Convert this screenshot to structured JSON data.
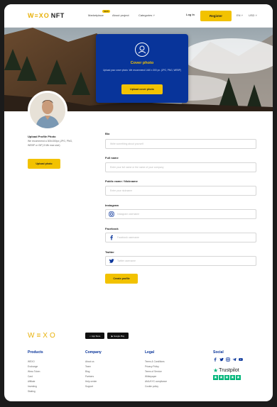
{
  "header": {
    "logo_main": "W≡XO",
    "logo_suffix": "NFT",
    "nav": [
      "Marketplace",
      "About project",
      "Categories ˅"
    ],
    "nav_badge": "NEW",
    "login": "Log In",
    "register": "Register",
    "language": "EN ˅",
    "currency": "USD ˅"
  },
  "cover": {
    "title": "Cover photo",
    "description": "Upload your cover photo. We recommend 1440 x 300 px. (JPG, PNG, WEBP)",
    "button": "Upload cover photo"
  },
  "profile_photo": {
    "title": "Upload Profile Photo",
    "description": "We recommend a 300x300px (JPG, PNG, WEBP or GIF) 5 Mb max size)",
    "button": "Upload photo"
  },
  "form": {
    "fields": [
      {
        "label": "Bio",
        "placeholder": "Write something about yourself"
      },
      {
        "label": "Full name",
        "placeholder": "Enter your full name or the name of your company"
      },
      {
        "label": "Public name / Nickname",
        "placeholder": "Enter your nickname"
      },
      {
        "label": "Instagram",
        "placeholder": "Instagram username",
        "icon": "instagram-icon"
      },
      {
        "label": "Facebook",
        "placeholder": "Facebook username",
        "icon": "facebook-icon"
      },
      {
        "label": "Twitter",
        "placeholder": "Twitter username",
        "icon": "twitter-icon"
      }
    ],
    "submit": "Create profile"
  },
  "footer": {
    "logo": "W≡XO",
    "app_store": "App Store",
    "google_play": "Google Play",
    "columns": [
      {
        "title": "Products",
        "links": [
          "WEXO",
          "Exchange",
          "Wexo Token",
          "Card",
          "Affiliate",
          "Investing",
          "Staking"
        ]
      },
      {
        "title": "Company",
        "links": [
          "About us",
          "Team",
          "Blog",
          "Partners",
          "Help center",
          "Support"
        ]
      },
      {
        "title": "Legal",
        "links": [
          "Terms & Conditions",
          "Privacy Policy",
          "Terms of Service",
          "Whitepaper",
          "AML/KYC compliance",
          "Cookie policy"
        ]
      },
      {
        "title": "Social",
        "links": []
      }
    ],
    "social_icons": [
      "facebook-icon",
      "twitter-icon",
      "instagram-icon",
      "telegram-icon",
      "youtube-icon"
    ],
    "trustpilot": "Trustpilot",
    "trustpilot_stars": 5
  },
  "colors": {
    "accent_yellow": "#f2c200",
    "cover_card_blue": "#08349a",
    "trustpilot_green": "#00b67a"
  }
}
